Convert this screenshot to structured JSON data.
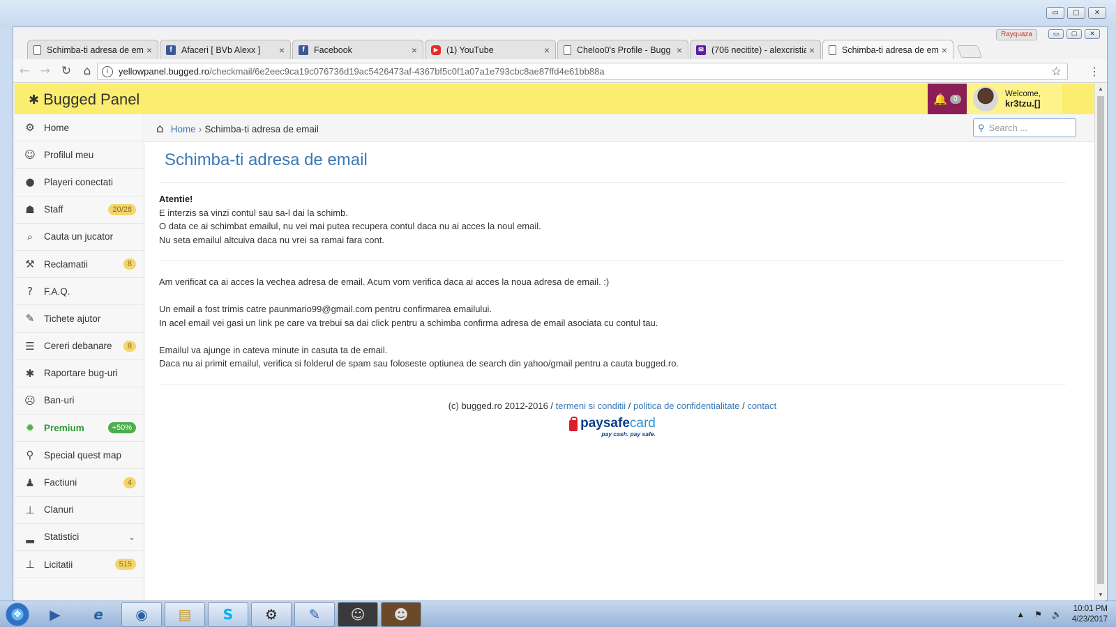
{
  "os": {
    "window_controls": [
      "▭",
      "▢",
      "✕"
    ],
    "taskbar": {
      "apps": [
        "media-player",
        "internet-explorer",
        "chrome",
        "file-explorer",
        "skype",
        "steam",
        "notepad",
        "game-1",
        "game-2"
      ],
      "tray_icons": [
        "▲",
        "⚑",
        "🔊"
      ],
      "time": "10:01 PM",
      "date": "4/23/2017"
    }
  },
  "browser": {
    "profile_name": "Rayquaza",
    "tabs": [
      {
        "label": "Schimba-ti adresa de em",
        "icon": "page-icon",
        "active": false
      },
      {
        "label": "Afaceri [ BVb Alexx ]",
        "icon": "facebook-icon",
        "active": false
      },
      {
        "label": "Facebook",
        "icon": "facebook-icon",
        "active": false
      },
      {
        "label": "(1) YouTube",
        "icon": "youtube-icon",
        "active": false
      },
      {
        "label": "Cheloo0's Profile - Bugg",
        "icon": "page-icon",
        "active": false
      },
      {
        "label": "(706 necitite) - alexcristia",
        "icon": "mail-icon",
        "active": false
      },
      {
        "label": "Schimba-ti adresa de em",
        "icon": "page-icon",
        "active": true
      }
    ],
    "url_host": "yellowpanel.bugged.ro",
    "url_path": "/checkmail/6e2eec9ca19c076736d19ac5426473af-4367bf5c0f1a07a1e793cbc8ae87ffd4e61bb88a"
  },
  "panel": {
    "brand": "Bugged Panel",
    "notifications_count": "0",
    "welcome": "Welcome,",
    "username": "kr3tzu.[]",
    "sidebar": [
      {
        "label": "Home",
        "icon": "⚙",
        "name": "home",
        "badge": ""
      },
      {
        "label": "Profilul meu",
        "icon": "☺",
        "name": "profilul-meu",
        "badge": ""
      },
      {
        "label": "Playeri conectati",
        "icon": "●",
        "name": "playeri-conectati",
        "badge": ""
      },
      {
        "label": "Staff",
        "icon": "☗",
        "name": "staff",
        "badge": "20/28"
      },
      {
        "label": "Cauta un jucator",
        "icon": "⌕",
        "name": "cauta-un-jucator",
        "badge": ""
      },
      {
        "label": "Reclamatii",
        "icon": "⚒",
        "name": "reclamatii",
        "badge": "8"
      },
      {
        "label": "F.A.Q.",
        "icon": "?",
        "name": "faq",
        "badge": ""
      },
      {
        "label": "Tichete ajutor",
        "icon": "✎",
        "name": "tichete-ajutor",
        "badge": ""
      },
      {
        "label": "Cereri debanare",
        "icon": "☰",
        "name": "cereri-debanare",
        "badge": "8"
      },
      {
        "label": "Raportare bug-uri",
        "icon": "✱",
        "name": "raportare-bug-uri",
        "badge": ""
      },
      {
        "label": "Ban-uri",
        "icon": "☹",
        "name": "ban-uri",
        "badge": ""
      },
      {
        "label": "Premium",
        "icon": "✹",
        "name": "premium",
        "badge": "+50%"
      },
      {
        "label": "Special quest map",
        "icon": "⚲",
        "name": "special-quest-map",
        "badge": ""
      },
      {
        "label": "Factiuni",
        "icon": "♟",
        "name": "factiuni",
        "badge": "4"
      },
      {
        "label": "Clanuri",
        "icon": "⊥",
        "name": "clanuri",
        "badge": ""
      },
      {
        "label": "Statistici",
        "icon": "▂",
        "name": "statistici",
        "badge": "",
        "chevron": "⌄"
      },
      {
        "label": "Licitatii",
        "icon": "⊥",
        "name": "licitatii",
        "badge": "515"
      }
    ],
    "breadcrumb": {
      "home": "Home",
      "separator": "›",
      "current": "Schimba-ti adresa de email"
    },
    "search_placeholder": "Search ...",
    "page_title": "Schimba-ti adresa de email",
    "warning": {
      "heading": "Atentie!",
      "lines": [
        "E interzis sa vinzi contul sau sa-l dai la schimb.",
        "O data ce ai schimbat emailul, nu vei mai putea recupera contul daca nu ai acces la noul email.",
        "Nu seta emailul altcuiva daca nu vrei sa ramai fara cont."
      ]
    },
    "message": {
      "p1": "Am verificat ca ai acces la vechea adresa de email. Acum vom verifica daca ai acces la noua adresa de email. :)",
      "p2_line1": "Un email a fost trimis catre paunmario99@gmail.com pentru confirmarea emailului.",
      "p2_line2": "In acel email vei gasi un link pe care va trebui sa dai click pentru a schimba confirma adresa de email asociata cu contul tau.",
      "p3_line1": "Emailul va ajunge in cateva minute in casuta ta de email.",
      "p3_line2": "Daca nu ai primit emailul, verifica si folderul de spam sau foloseste optiunea de search din yahoo/gmail pentru a cauta bugged.ro."
    },
    "footer": {
      "copyright": "(c) bugged.ro 2012-2016 /",
      "terms": "termeni si conditii",
      "sep": "/",
      "privacy": "politica de confidentialitate",
      "contact": "contact",
      "psc_brand_a": "paysafe",
      "psc_brand_b": "card",
      "psc_tagline": "pay cash. pay safe."
    }
  }
}
